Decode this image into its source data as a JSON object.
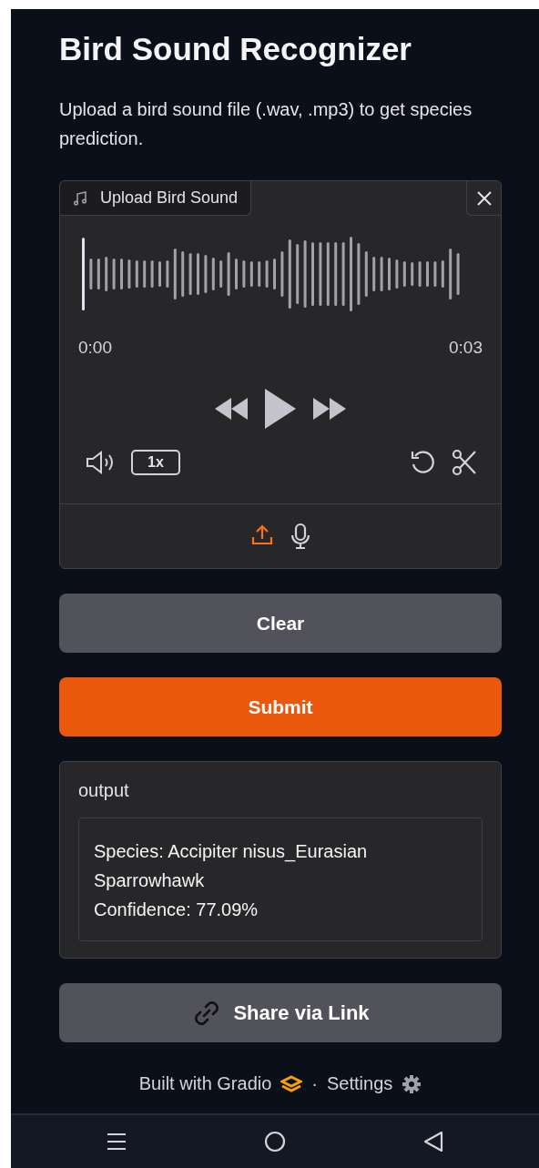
{
  "title": "Bird Sound Recognizer",
  "description": "Upload a bird sound file (.wav, .mp3) to get species prediction.",
  "audio_input": {
    "label": "Upload Bird Sound",
    "time_start": "0:00",
    "time_end": "0:03",
    "speed": "1x",
    "sources": [
      {
        "kind": "upload",
        "selected": true
      },
      {
        "kind": "microphone",
        "selected": false
      }
    ]
  },
  "buttons": [
    {
      "label": "Clear",
      "kind": "secondary"
    },
    {
      "label": "Submit",
      "kind": "primary"
    }
  ],
  "output": {
    "label": "output",
    "lines": [
      "Species: Accipiter nisus_Eurasian Sparrowhawk",
      "Confidence: 77.09%"
    ]
  },
  "share_button": {
    "label": "Share via Link"
  },
  "footer": {
    "built_with": "Built with Gradio",
    "separator": "·",
    "settings": "Settings"
  }
}
